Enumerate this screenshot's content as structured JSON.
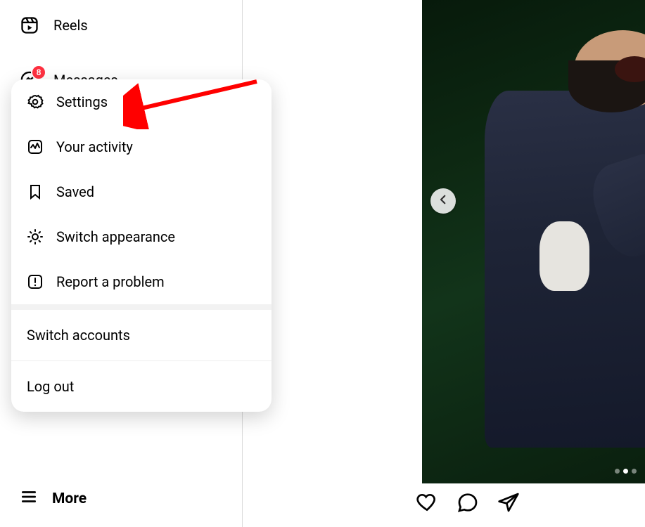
{
  "sidebar": {
    "reels_label": "Reels",
    "messages_label": "Messages",
    "messages_badge": "8",
    "more_label": "More"
  },
  "menu": {
    "settings": "Settings",
    "activity": "Your activity",
    "saved": "Saved",
    "appearance": "Switch appearance",
    "report": "Report a problem",
    "switch_accounts": "Switch accounts",
    "logout": "Log out"
  },
  "post": {
    "carousel_total": 3,
    "carousel_active_index": 1
  },
  "colors": {
    "badge": "#ff3040",
    "arrow": "#ff0000"
  }
}
